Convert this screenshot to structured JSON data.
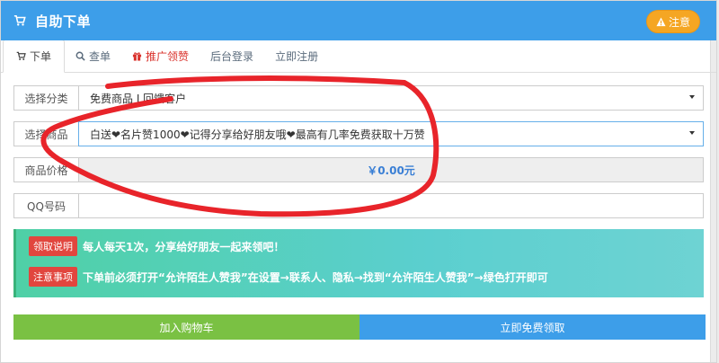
{
  "header": {
    "title": "自助下单",
    "notice_label": "注意"
  },
  "tabs": [
    {
      "label": "下单",
      "icon": "cart-icon",
      "active": true
    },
    {
      "label": "查单",
      "icon": "search-icon",
      "active": false
    },
    {
      "label": "推广领赞",
      "icon": "gift-icon",
      "active": false
    },
    {
      "label": "后台登录",
      "icon": "",
      "active": false
    },
    {
      "label": "立即注册",
      "icon": "",
      "active": false
    }
  ],
  "form": {
    "category": {
      "label": "选择分类",
      "value": "免费商品 I 回馈客户"
    },
    "product": {
      "label": "选择商品",
      "value": "白送❤名片赞1000❤记得分享给好朋友哦❤最高有几率免费获取十万赞"
    },
    "price": {
      "label": "商品价格",
      "value": "￥0.00元"
    },
    "qq": {
      "label": "QQ号码",
      "value": ""
    }
  },
  "info": {
    "claim_tag": "领取说明",
    "claim_text": "每人每天1次，分享给好朋友一起来领吧！",
    "notice_tag": "注意事项",
    "notice_text": "下单前必须打开“允许陌生人赞我”在设置→联系人、隐私→找到“允许陌生人赞我”→绿色打开即可"
  },
  "actions": {
    "add_cart": "加入购物车",
    "claim_free": "立即免费领取"
  },
  "colors": {
    "primary": "#3d9ee9",
    "warning": "#f5a623",
    "success": "#7ac143",
    "danger": "#e1463e",
    "scribble": "#e8242a"
  }
}
